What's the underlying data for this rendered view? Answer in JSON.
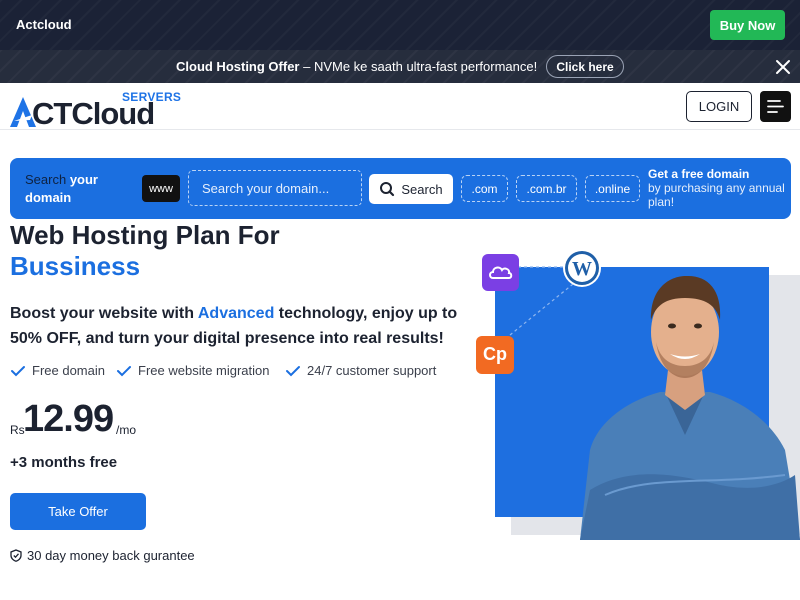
{
  "topbar": {
    "brand": "Actcloud",
    "buy_label": "Buy Now"
  },
  "offer": {
    "title": "Cloud Hosting Offer",
    "text": " – NVMe ke saath ultra-fast performance!",
    "cta": "Click here"
  },
  "header": {
    "logo_tag": "SERVERS",
    "logo_word": "CTCloud",
    "login_label": "LOGIN"
  },
  "domain_search": {
    "label_part1": "Search",
    "label_part2": " your domain",
    "www": "www",
    "placeholder": "Search your domain...",
    "search_label": "Search",
    "tlds": [
      ".com",
      ".com.br",
      ".online"
    ],
    "promo_title": "Get a free domain",
    "promo_text": "by purchasing any annual plan!"
  },
  "hero": {
    "title_line1": "Web Hosting Plan For",
    "title_line2": "Bussiness",
    "sub_before": "Boost your website with ",
    "sub_highlight": "Advanced",
    "sub_after": " technology, enjoy up to 50% OFF, and turn your digital presence into real results!",
    "features": [
      "Free domain",
      "Free website migration",
      "24/7 customer support"
    ],
    "price_currency": "Rs",
    "price_value": "12.99",
    "price_period": "/mo",
    "bonus": "+3 months free",
    "cta_label": "Take Offer",
    "guarantee": "30 day money back gurantee"
  },
  "illustration": {
    "icons": [
      "cloud-icon",
      "wordpress-icon",
      "cpanel-icon"
    ],
    "cpanel_text": "Cp"
  },
  "colors": {
    "primary": "#1b6fe0",
    "dark": "#1c2230",
    "topbar": "#1b2236",
    "buy": "#22b856",
    "cloud_icon_bg": "#7b3fe4",
    "cpanel_icon_bg": "#f26a22"
  }
}
